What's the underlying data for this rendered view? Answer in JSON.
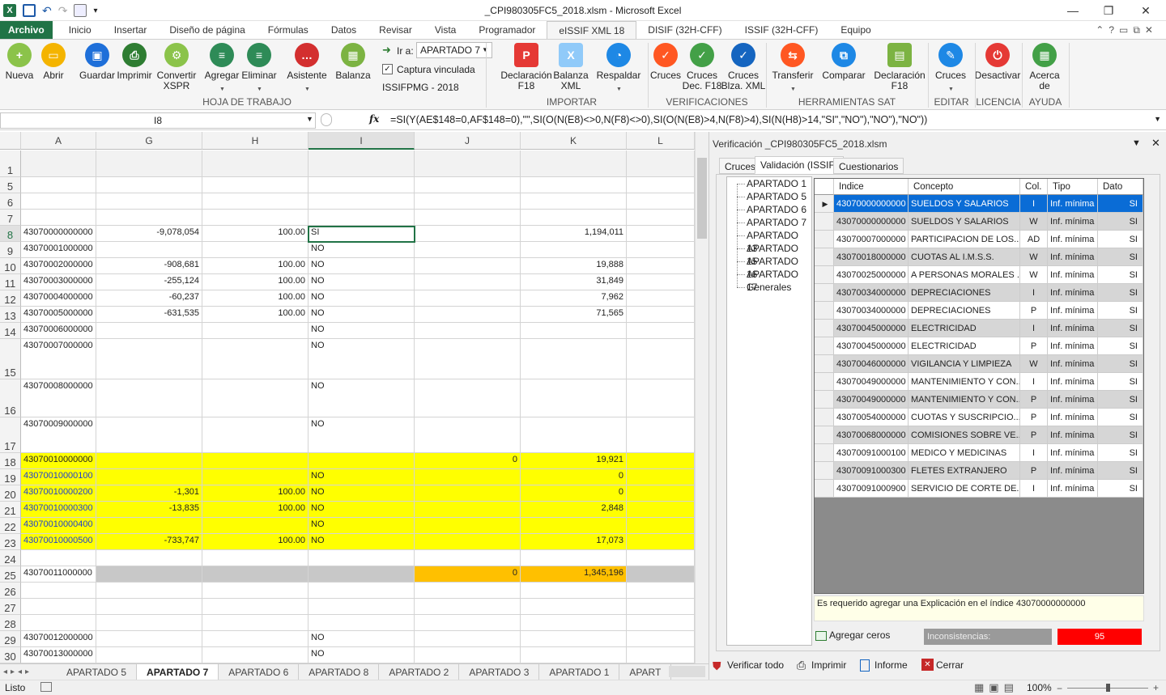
{
  "window": {
    "title": "_CPI980305FC5_2018.xlsm  -  Microsoft Excel"
  },
  "tabs": [
    "Archivo",
    "Inicio",
    "Insertar",
    "Diseño de página",
    "Fórmulas",
    "Datos",
    "Revisar",
    "Vista",
    "Programador",
    "eISSIF XML 18",
    "DISIF (32H-CFF)",
    "ISSIF (32H-CFF)",
    "Equipo"
  ],
  "ribbon": {
    "buttons": [
      {
        "label": "Nueva",
        "color": "#8bc34a",
        "glyph": "+"
      },
      {
        "label": "Abrir",
        "color": "#f4b400",
        "glyph": "▭"
      },
      {
        "label": "Guardar",
        "color": "#1e6fd9",
        "glyph": "▣"
      },
      {
        "label": "Imprimir",
        "color": "#2e7d32",
        "glyph": "⎙"
      },
      {
        "label": "Convertir\nXSPR",
        "color": "#8bc34a",
        "glyph": "⚙"
      },
      {
        "label": "Agregar",
        "color": "#2e8b57",
        "glyph": "≡"
      },
      {
        "label": "Eliminar",
        "color": "#2e8b57",
        "glyph": "≡"
      },
      {
        "label": "Asistente",
        "color": "#d32f2f",
        "glyph": "…"
      },
      {
        "label": "Balanza",
        "color": "#7cb342",
        "glyph": "▦"
      },
      {
        "label": "Declaración\nF18",
        "color": "#e53935",
        "glyph": "P"
      },
      {
        "label": "Balanza\nXML",
        "color": "#90caf9",
        "glyph": "X"
      },
      {
        "label": "Respaldar",
        "color": "#1e88e5",
        "glyph": "◔"
      },
      {
        "label": "Cruces",
        "color": "#ff5722",
        "glyph": "✓"
      },
      {
        "label": "Cruces\nDec. F18",
        "color": "#43a047",
        "glyph": "✓"
      },
      {
        "label": "Cruces\nBlza. XML",
        "color": "#1565c0",
        "glyph": "✓"
      },
      {
        "label": "Transferir",
        "color": "#ff5722",
        "glyph": "⇆"
      },
      {
        "label": "Comparar",
        "color": "#1e88e5",
        "glyph": "⧉"
      },
      {
        "label": "Declaración\nF18",
        "color": "#7cb342",
        "glyph": "▤"
      },
      {
        "label": "Cruces",
        "color": "#1e88e5",
        "glyph": "✎"
      },
      {
        "label": "Desactivar",
        "color": "#e53935",
        "glyph": "⏻"
      },
      {
        "label": "Acerca\nde",
        "color": "#43a047",
        "glyph": "▦"
      }
    ],
    "goto_label": "Ir a:",
    "goto_value": "APARTADO 7",
    "captura_label": "Captura vinculada",
    "issif_label": "ISSIFPMG - 2018",
    "groups": [
      "HOJA DE TRABAJO",
      "IMPORTAR",
      "VERIFICACIONES",
      "HERRAMIENTAS SAT",
      "EDITAR",
      "LICENCIA",
      "AYUDA"
    ]
  },
  "formula_bar": {
    "name_box": "I8",
    "fx": "fx",
    "formula": "=SI(Y(AE$148=0,AF$148=0),\"\",SI(O(N(E8)<>0,N(F8)<>0),SI(O(N(E8)>4,N(F8)>4),SI(N(H8)>14,\"SI\",\"NO\"),\"NO\"),\"NO\"))"
  },
  "columns": [
    "A",
    "G",
    "H",
    "I",
    "J",
    "K",
    "L"
  ],
  "rows": [
    {
      "n": "1",
      "a": "",
      "g": "",
      "h": "",
      "i": "",
      "j": "",
      "k": ""
    },
    {
      "n": "5",
      "a": "",
      "g": "",
      "h": "",
      "i": "",
      "j": "",
      "k": ""
    },
    {
      "n": "6",
      "a": "",
      "g": "",
      "h": "",
      "i": "",
      "j": "",
      "k": ""
    },
    {
      "n": "7",
      "a": "",
      "g": "",
      "h": "",
      "i": "",
      "j": "",
      "k": ""
    },
    {
      "n": "8",
      "a": "43070000000000",
      "g": "-9,078,054",
      "h": "100.00",
      "i": "SI",
      "j": "",
      "k": "1,194,011"
    },
    {
      "n": "9",
      "a": "43070001000000",
      "g": "",
      "h": "",
      "i": "NO",
      "j": "",
      "k": ""
    },
    {
      "n": "10",
      "a": "43070002000000",
      "g": "-908,681",
      "h": "100.00",
      "i": "NO",
      "j": "",
      "k": "19,888"
    },
    {
      "n": "11",
      "a": "43070003000000",
      "g": "-255,124",
      "h": "100.00",
      "i": "NO",
      "j": "",
      "k": "31,849"
    },
    {
      "n": "12",
      "a": "43070004000000",
      "g": "-60,237",
      "h": "100.00",
      "i": "NO",
      "j": "",
      "k": "7,962"
    },
    {
      "n": "13",
      "a": "43070005000000",
      "g": "-631,535",
      "h": "100.00",
      "i": "NO",
      "j": "",
      "k": "71,565"
    },
    {
      "n": "14",
      "a": "43070006000000",
      "g": "",
      "h": "",
      "i": "NO",
      "j": "",
      "k": ""
    },
    {
      "n": "15",
      "a": "43070007000000",
      "g": "",
      "h": "",
      "i": "NO",
      "j": "",
      "k": ""
    },
    {
      "n": "16",
      "a": "43070008000000",
      "g": "",
      "h": "",
      "i": "NO",
      "j": "",
      "k": ""
    },
    {
      "n": "17",
      "a": "43070009000000",
      "g": "",
      "h": "",
      "i": "NO",
      "j": "",
      "k": ""
    },
    {
      "n": "18",
      "a": "43070010000000",
      "g": "",
      "h": "",
      "i": "",
      "j": "0",
      "k": "19,921"
    },
    {
      "n": "19",
      "a": "43070010000100",
      "g": "",
      "h": "",
      "i": "NO",
      "j": "",
      "k": "0"
    },
    {
      "n": "20",
      "a": "43070010000200",
      "g": "-1,301",
      "h": "100.00",
      "i": "NO",
      "j": "",
      "k": "0"
    },
    {
      "n": "21",
      "a": "43070010000300",
      "g": "-13,835",
      "h": "100.00",
      "i": "NO",
      "j": "",
      "k": "2,848"
    },
    {
      "n": "22",
      "a": "43070010000400",
      "g": "",
      "h": "",
      "i": "NO",
      "j": "",
      "k": ""
    },
    {
      "n": "23",
      "a": "43070010000500",
      "g": "-733,747",
      "h": "100.00",
      "i": "NO",
      "j": "",
      "k": "17,073"
    },
    {
      "n": "24",
      "a": "",
      "g": "",
      "h": "",
      "i": "",
      "j": "",
      "k": ""
    },
    {
      "n": "25",
      "a": "43070011000000",
      "g": "",
      "h": "",
      "i": "",
      "j": "0",
      "k": "1,345,196"
    },
    {
      "n": "26",
      "a": "",
      "g": "",
      "h": "",
      "i": "",
      "j": "",
      "k": ""
    },
    {
      "n": "27",
      "a": "",
      "g": "",
      "h": "",
      "i": "",
      "j": "",
      "k": ""
    },
    {
      "n": "28",
      "a": "",
      "g": "",
      "h": "",
      "i": "",
      "j": "",
      "k": ""
    },
    {
      "n": "29",
      "a": "43070012000000",
      "g": "",
      "h": "",
      "i": "NO",
      "j": "",
      "k": ""
    },
    {
      "n": "30",
      "a": "43070013000000",
      "g": "",
      "h": "",
      "i": "NO",
      "j": "",
      "k": ""
    }
  ],
  "sheet_tabs": [
    "APARTADO 5",
    "APARTADO 7",
    "APARTADO 6",
    "APARTADO 8",
    "APARTADO 2",
    "APARTADO 3",
    "APARTADO 1",
    "APART"
  ],
  "status": {
    "ready": "Listo",
    "zoom": "100%"
  },
  "panel": {
    "title": "Verificación _CPI980305FC5_2018.xlsm",
    "tabs": [
      "Cruces",
      "Validación (ISSIF)",
      "Cuestionarios"
    ],
    "tree": [
      "APARTADO 1",
      "APARTADO 5",
      "APARTADO 6",
      "APARTADO 7",
      "APARTADO 13",
      "APARTADO 15",
      "APARTADO 16",
      "APARTADO 17",
      "Generales"
    ],
    "headers": [
      "Indice",
      "Concepto",
      "Col.",
      "Tipo",
      "Dato"
    ],
    "rows": [
      {
        "indice": "43070000000000",
        "concepto": "SUELDOS Y SALARIOS",
        "col": "I",
        "tipo": "Inf. mínima",
        "dato": "SI"
      },
      {
        "indice": "43070000000000",
        "concepto": "SUELDOS Y SALARIOS",
        "col": "W",
        "tipo": "Inf. mínima",
        "dato": "SI"
      },
      {
        "indice": "43070007000000",
        "concepto": "PARTICIPACION DE LOS...",
        "col": "AD",
        "tipo": "Inf. mínima",
        "dato": "SI"
      },
      {
        "indice": "43070018000000",
        "concepto": "CUOTAS AL I.M.S.S.",
        "col": "W",
        "tipo": "Inf. mínima",
        "dato": "SI"
      },
      {
        "indice": "43070025000000",
        "concepto": "A PERSONAS MORALES ...",
        "col": "W",
        "tipo": "Inf. mínima",
        "dato": "SI"
      },
      {
        "indice": "43070034000000",
        "concepto": "DEPRECIACIONES",
        "col": "I",
        "tipo": "Inf. mínima",
        "dato": "SI"
      },
      {
        "indice": "43070034000000",
        "concepto": "DEPRECIACIONES",
        "col": "P",
        "tipo": "Inf. mínima",
        "dato": "SI"
      },
      {
        "indice": "43070045000000",
        "concepto": "ELECTRICIDAD",
        "col": "I",
        "tipo": "Inf. mínima",
        "dato": "SI"
      },
      {
        "indice": "43070045000000",
        "concepto": "ELECTRICIDAD",
        "col": "P",
        "tipo": "Inf. mínima",
        "dato": "SI"
      },
      {
        "indice": "43070046000000",
        "concepto": "VIGILANCIA Y LIMPIEZA",
        "col": "W",
        "tipo": "Inf. mínima",
        "dato": "SI"
      },
      {
        "indice": "43070049000000",
        "concepto": "MANTENIMIENTO Y CON...",
        "col": "I",
        "tipo": "Inf. mínima",
        "dato": "SI"
      },
      {
        "indice": "43070049000000",
        "concepto": "MANTENIMIENTO Y CON...",
        "col": "P",
        "tipo": "Inf. mínima",
        "dato": "SI"
      },
      {
        "indice": "43070054000000",
        "concepto": "CUOTAS Y SUSCRIPCIO...",
        "col": "P",
        "tipo": "Inf. mínima",
        "dato": "SI"
      },
      {
        "indice": "43070068000000",
        "concepto": "COMISIONES SOBRE VE...",
        "col": "P",
        "tipo": "Inf. mínima",
        "dato": "SI"
      },
      {
        "indice": "43070091000100",
        "concepto": "MEDICO  Y MEDICINAS",
        "col": "I",
        "tipo": "Inf. mínima",
        "dato": "SI"
      },
      {
        "indice": "43070091000300",
        "concepto": "FLETES EXTRANJERO",
        "col": "P",
        "tipo": "Inf. mínima",
        "dato": "SI"
      },
      {
        "indice": "43070091000900",
        "concepto": "SERVICIO DE CORTE DE...",
        "col": "I",
        "tipo": "Inf. mínima",
        "dato": "SI"
      }
    ],
    "message": "Es requerido agregar una Explicación en el índice 43070000000000",
    "agregar_ceros": "Agregar ceros",
    "inconsistencias_label": "Inconsistencias:",
    "inconsistencias_count": "95",
    "footer": [
      "Verificar todo",
      "Imprimir",
      "Informe",
      "Cerrar"
    ]
  }
}
